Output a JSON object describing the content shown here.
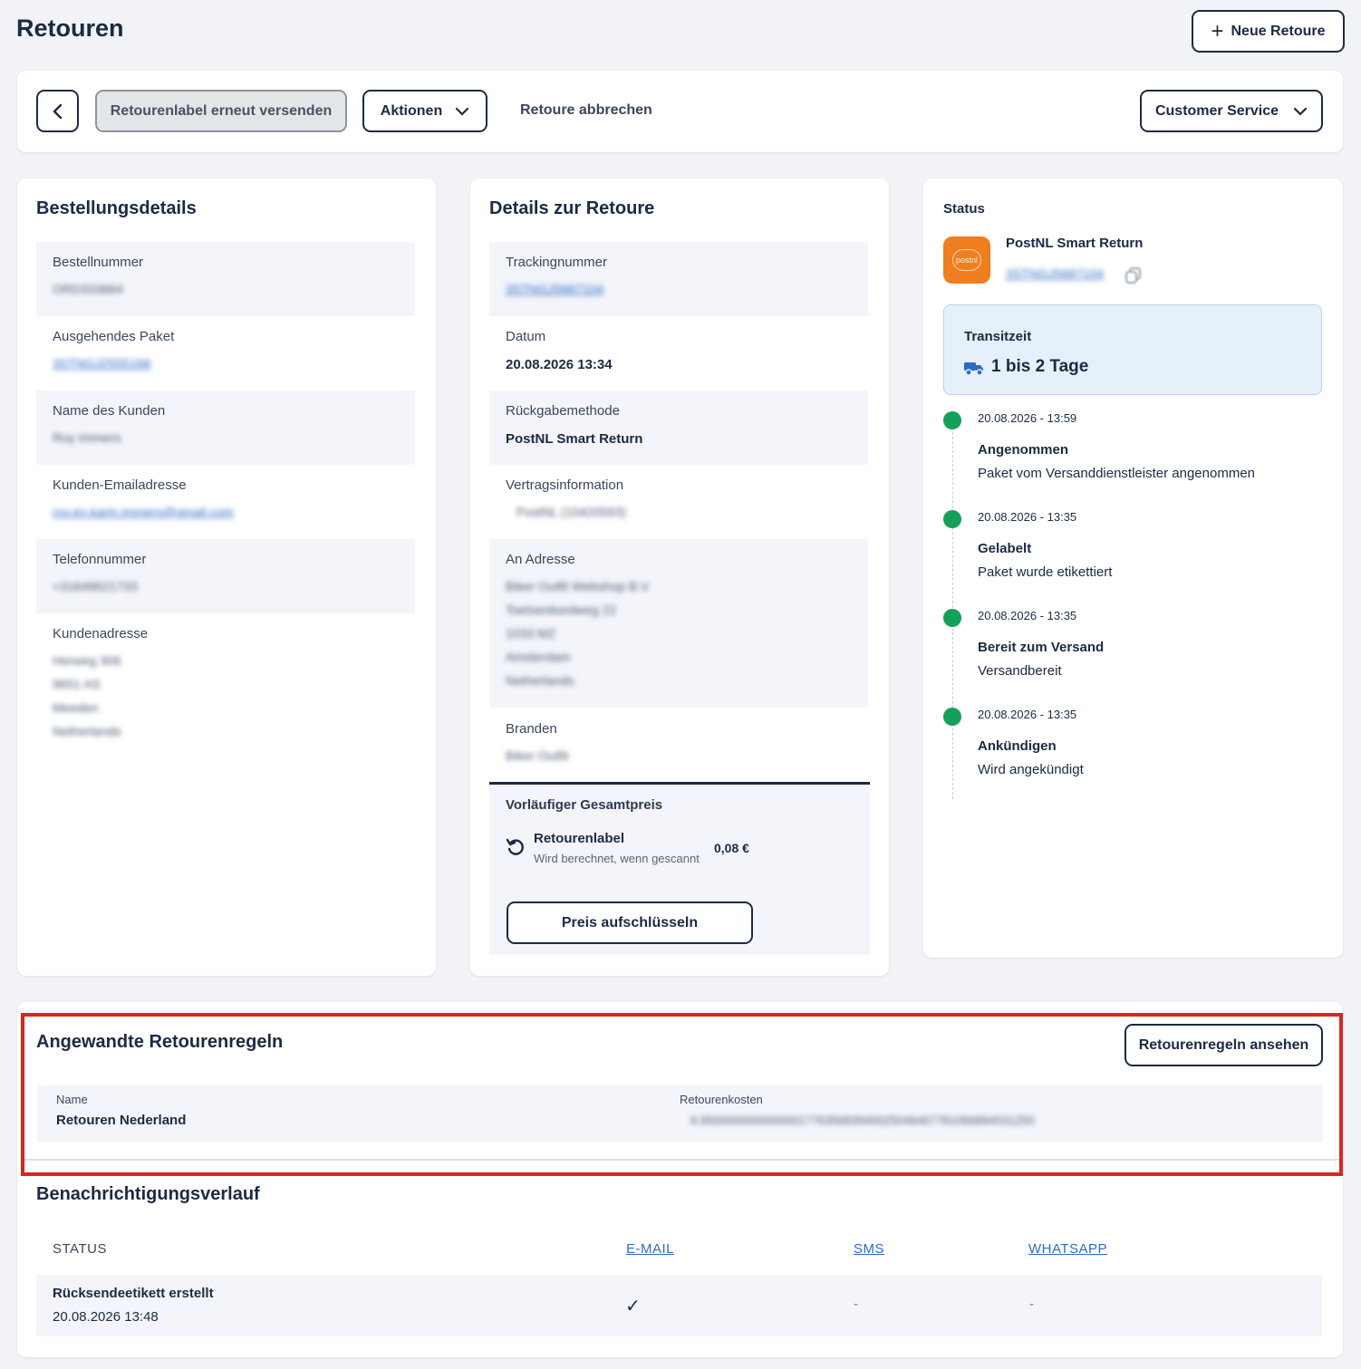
{
  "page": {
    "title": "Retouren",
    "new_return_label": "Neue Retoure"
  },
  "toolbar": {
    "resend_label": "Retourenlabel erneut versenden",
    "actions_label": "Aktionen",
    "cancel_label": "Retoure abbrechen",
    "customer_service_label": "Customer Service"
  },
  "order_details": {
    "title": "Bestellungsdetails",
    "order_number": {
      "label": "Bestellnummer",
      "value": "ORD333664"
    },
    "outgoing_package": {
      "label": "Ausgehendes Paket",
      "value": "3STNGJ2555168"
    },
    "customer_name": {
      "label": "Name des Kunden",
      "value": "Roy Immers"
    },
    "customer_email": {
      "label": "Kunden-Emailadresse",
      "value": "roy.en.karin.immers@gmail.com"
    },
    "phone": {
      "label": "Telefonnummer",
      "value": "+31648621733"
    },
    "address": {
      "label": "Kundenadresse",
      "lines": [
        "Herweg 306",
        "9651 AS",
        "Meeden",
        "Netherlands"
      ]
    }
  },
  "return_details": {
    "title": "Details zur Retoure",
    "tracking": {
      "label": "Trackingnummer",
      "value": "3STNGJ5687104"
    },
    "date": {
      "label": "Datum",
      "value": "20.08.2026 13:34"
    },
    "method": {
      "label": "Rückgabemethode",
      "value": "PostNL Smart Return"
    },
    "contract": {
      "label": "Vertragsinformation",
      "value": "PostNL (10420593)"
    },
    "to_address": {
      "label": "An Adresse",
      "lines": [
        "Biker Outfit Webshop B.V",
        "Toetsenbordweg 22",
        "1033 MZ",
        "Amsterdam",
        "Netherlands"
      ]
    },
    "brand": {
      "label": "Branden",
      "value": "Biker Outfit"
    },
    "price": {
      "label": "Vorläufiger Gesamtpreis",
      "item_title": "Retourenlabel",
      "item_note": "Wird berechnet, wenn gescannt",
      "amount": "0,08 €",
      "breakdown_label": "Preis aufschlüsseln"
    }
  },
  "status": {
    "title": "Status",
    "carrier_name": "PostNL Smart Return",
    "carrier_logo_text": "postnl",
    "tracking": "3STNGJ5687104",
    "transit_label": "Transitzeit",
    "transit_value": "1 bis 2 Tage",
    "timeline": [
      {
        "date": "20.08.2026 - 13:59",
        "title": "Angenommen",
        "desc": "Paket vom Versanddienstleister angenommen"
      },
      {
        "date": "20.08.2026 - 13:35",
        "title": "Gelabelt",
        "desc": "Paket wurde etikettiert"
      },
      {
        "date": "20.08.2026 - 13:35",
        "title": "Bereit zum Versand",
        "desc": "Versandbereit"
      },
      {
        "date": "20.08.2026 - 13:35",
        "title": "Ankündigen",
        "desc": "Wird angekündigt"
      }
    ]
  },
  "rules": {
    "title": "Angewandte Retourenregeln",
    "view_label": "Retourenregeln ansehen",
    "col_name": "Name",
    "col_costs": "Retourenkosten",
    "row_name": "Retouren Nederland",
    "row_costs": "6.950000000000000177635683940025046467781066894531250"
  },
  "notifications": {
    "title": "Benachrichtigungsverlauf",
    "headers": [
      "STATUS",
      "E-MAIL",
      "SMS",
      "WHATSAPP"
    ],
    "row": {
      "status": "Rücksendeetikett erstellt",
      "date": "20.08.2026 13:48",
      "email": "✓",
      "sms": "-",
      "whatsapp": "-"
    }
  },
  "colors": {
    "navy": "#1b2a44",
    "link": "#2d6ac6",
    "green": "#15a05a",
    "highlight": "#d9261c",
    "postnl": "#f07d1e"
  }
}
